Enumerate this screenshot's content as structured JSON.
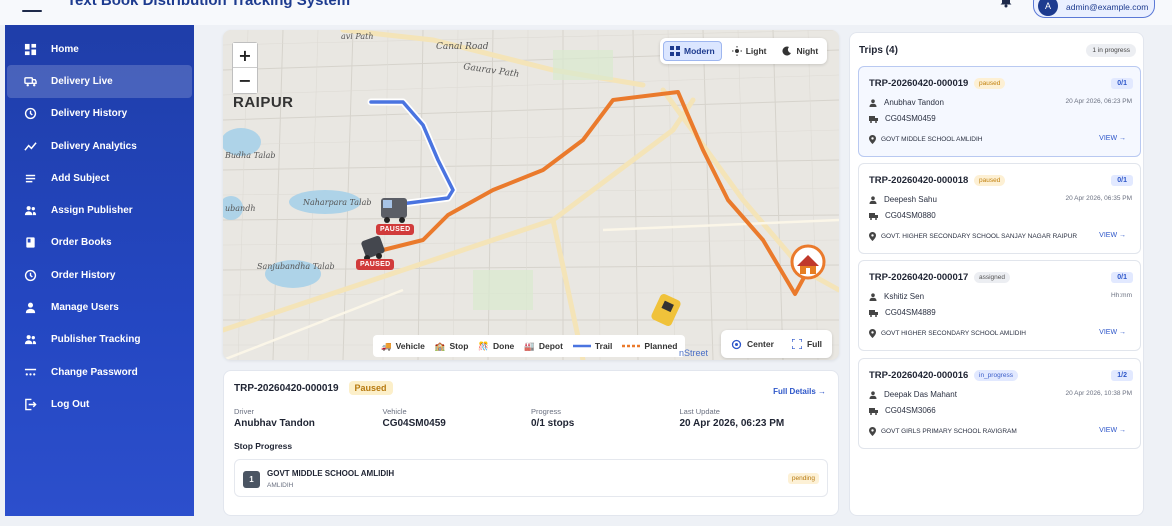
{
  "header": {
    "title": "Text Book Distribution Tracking System",
    "user_email": "admin@example.com",
    "avatar_initial": "A"
  },
  "sidebar": {
    "items": [
      {
        "label": "Home",
        "icon": "dashboard-icon"
      },
      {
        "label": "Delivery Live",
        "icon": "truck-icon",
        "active": true
      },
      {
        "label": "Delivery History",
        "icon": "history-icon"
      },
      {
        "label": "Delivery Analytics",
        "icon": "analytics-icon"
      },
      {
        "label": "Add Subject",
        "icon": "list-icon"
      },
      {
        "label": "Assign Publisher",
        "icon": "people-icon"
      },
      {
        "label": "Order Books",
        "icon": "book-icon"
      },
      {
        "label": "Order History",
        "icon": "history-icon"
      },
      {
        "label": "Manage Users",
        "icon": "person-icon"
      },
      {
        "label": "Publisher Tracking",
        "icon": "people-icon"
      },
      {
        "label": "Change Password",
        "icon": "password-icon"
      },
      {
        "label": "Log Out",
        "icon": "logout-icon"
      }
    ]
  },
  "map": {
    "city": "RAIPUR",
    "labels": {
      "road1": "avi Path",
      "road2": "Canal Road",
      "road3": "Gaurav Path",
      "lake1": "Budha Talab",
      "lake2": "Naharpara Talab",
      "lake3": "Sanjubandha Talab",
      "lake4": "ubandh"
    },
    "paused_label": "PAUSED",
    "theme_modern": "Modern",
    "theme_light": "Light",
    "theme_night": "Night",
    "zoom_in": "+",
    "zoom_out": "−",
    "legend": {
      "vehicle": "Vehicle",
      "stop": "Stop",
      "done": "Done",
      "depot": "Depot",
      "trail": "Trail",
      "planned": "Planned"
    },
    "attribution": "nStreet",
    "center_label": "Center",
    "full_label": "Full",
    "colors": {
      "trail": "#4a74e0",
      "planned": "#ea7a2c",
      "paused": "#d13b3b"
    }
  },
  "detail": {
    "trip_id": "TRP-20260420-000019",
    "status": "Paused",
    "full_details": "Full Details →",
    "fields": [
      {
        "label": "Driver",
        "value": "Anubhav Tandon"
      },
      {
        "label": "Vehicle",
        "value": "CG04SM0459"
      },
      {
        "label": "Progress",
        "value": "0/1 stops"
      },
      {
        "label": "Last Update",
        "value": "20 Apr 2026, 06:23 PM"
      }
    ],
    "stop_progress_title": "Stop Progress",
    "stop": {
      "num": "1",
      "name": "GOVT MIDDLE SCHOOL AMLIDIH",
      "area": "AMLIDIH",
      "state": "pending"
    }
  },
  "trips": {
    "title": "Trips (4)",
    "in_progress_badge": "1 in progress",
    "view_label": "VIEW →",
    "items": [
      {
        "id": "TRP-20260420-000019",
        "status": "paused",
        "count": "0/1",
        "driver": "Anubhav Tandon",
        "time": "20 Apr 2026, 06:23 PM",
        "vehicle": "CG04SM0459",
        "school": "GOVT MIDDLE SCHOOL AMLIDIH"
      },
      {
        "id": "TRP-20260420-000018",
        "status": "paused",
        "count": "0/1",
        "driver": "Deepesh Sahu",
        "time": "20 Apr 2026, 06:35 PM",
        "vehicle": "CG04SM0880",
        "school": "GOVT. HIGHER SECONDARY SCHOOL SANJAY NAGAR RAIPUR"
      },
      {
        "id": "TRP-20260420-000017",
        "status": "assigned",
        "count": "0/1",
        "driver": "Kshitiz Sen",
        "time": "Hh:mm",
        "vehicle": "CG04SM4889",
        "school": "GOVT HIGHER SECONDARY SCHOOL AMLIDIH"
      },
      {
        "id": "TRP-20260420-000016",
        "status": "in_progress",
        "count": "1/2",
        "driver": "Deepak Das Mahant",
        "time": "20 Apr 2026, 10:38 PM",
        "vehicle": "CG04SM3066",
        "school": "GOVT GIRLS PRIMARY SCHOOL RAVIGRAM"
      }
    ]
  }
}
